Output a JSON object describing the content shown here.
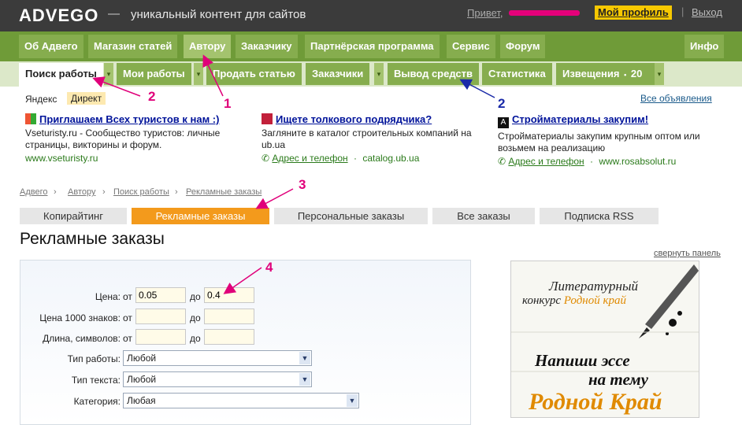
{
  "header": {
    "logo": "ADVEGO",
    "dash": "—",
    "tagline": "уникальный контент для сайтов",
    "greeting": "Привет,",
    "profile": "Мой профиль",
    "separator": "|",
    "logout": "Выход"
  },
  "nav_main": [
    "Об Адвего",
    "Магазин статей",
    "Автору",
    "Заказчику",
    "Партнёрская программа",
    "Сервис",
    "Форум",
    "Инфо"
  ],
  "nav_sub": {
    "search": "Поиск работы",
    "my_jobs": "Мои работы",
    "sell": "Продать статью",
    "clients": "Заказчики",
    "withdraw": "Вывод средств",
    "stats": "Статистика",
    "notices": "Извещения",
    "notices_count": "20",
    "dd": "▾",
    "bullet": "•"
  },
  "ads": {
    "yandex": "Яндекс",
    "direct": "Директ",
    "all": "Все объявления",
    "items": [
      {
        "title": "Приглашаем Всех туристов к нам :)",
        "text": "Vseturisty.ru - Сообщество туристов: личные страницы, викторины и форум.",
        "url": "www.vseturisty.ru"
      },
      {
        "title": "Ищете толкового подрядчика?",
        "text": "Загляните в каталог строительных компаний на ub.ua",
        "contact": "Адрес и телефон",
        "sep": "·",
        "url": "catalog.ub.ua"
      },
      {
        "title": "Стройматериалы закупим!",
        "text": "Стройматериалы закупим крупным оптом или возьмем на реализацию",
        "contact": "Адрес и телефон",
        "sep": "·",
        "url": "www.rosabsolut.ru"
      }
    ]
  },
  "breadcrumb": [
    "Адвего",
    "Автору",
    "Поиск работы",
    "Рекламные заказы"
  ],
  "crumb_sep": "›",
  "tabs": [
    "Копирайтинг",
    "Рекламные заказы",
    "Персональные заказы",
    "Все заказы",
    "Подписка RSS"
  ],
  "page_title": "Рекламные заказы",
  "collapse": "свернуть панель",
  "form": {
    "price_label": "Цена:",
    "price_from": "0.05",
    "price_to": "0.4",
    "price1000_label": "Цена 1000 знаков:",
    "length_label": "Длина, символов:",
    "from": "от",
    "to": "до",
    "worktype_label": "Тип работы:",
    "worktype": "Любой",
    "texttype_label": "Тип текста:",
    "texttype": "Любой",
    "category_label": "Категория:",
    "category": "Любая",
    "arrow": "▼"
  },
  "banner": {
    "line1": "Литературный",
    "line2": "конкурс",
    "line2b": "Родной край",
    "line3": "Напиши эссе",
    "line4": "на тему",
    "line5": "Родной Край"
  },
  "annotations": [
    "1",
    "2",
    "2",
    "3",
    "4"
  ],
  "colors": {
    "accent_orange": "#f39a1c",
    "nav_green": "#6f9b38",
    "annotation_magenta": "#e0007a",
    "annotation_blue": "#1a2aa8"
  }
}
